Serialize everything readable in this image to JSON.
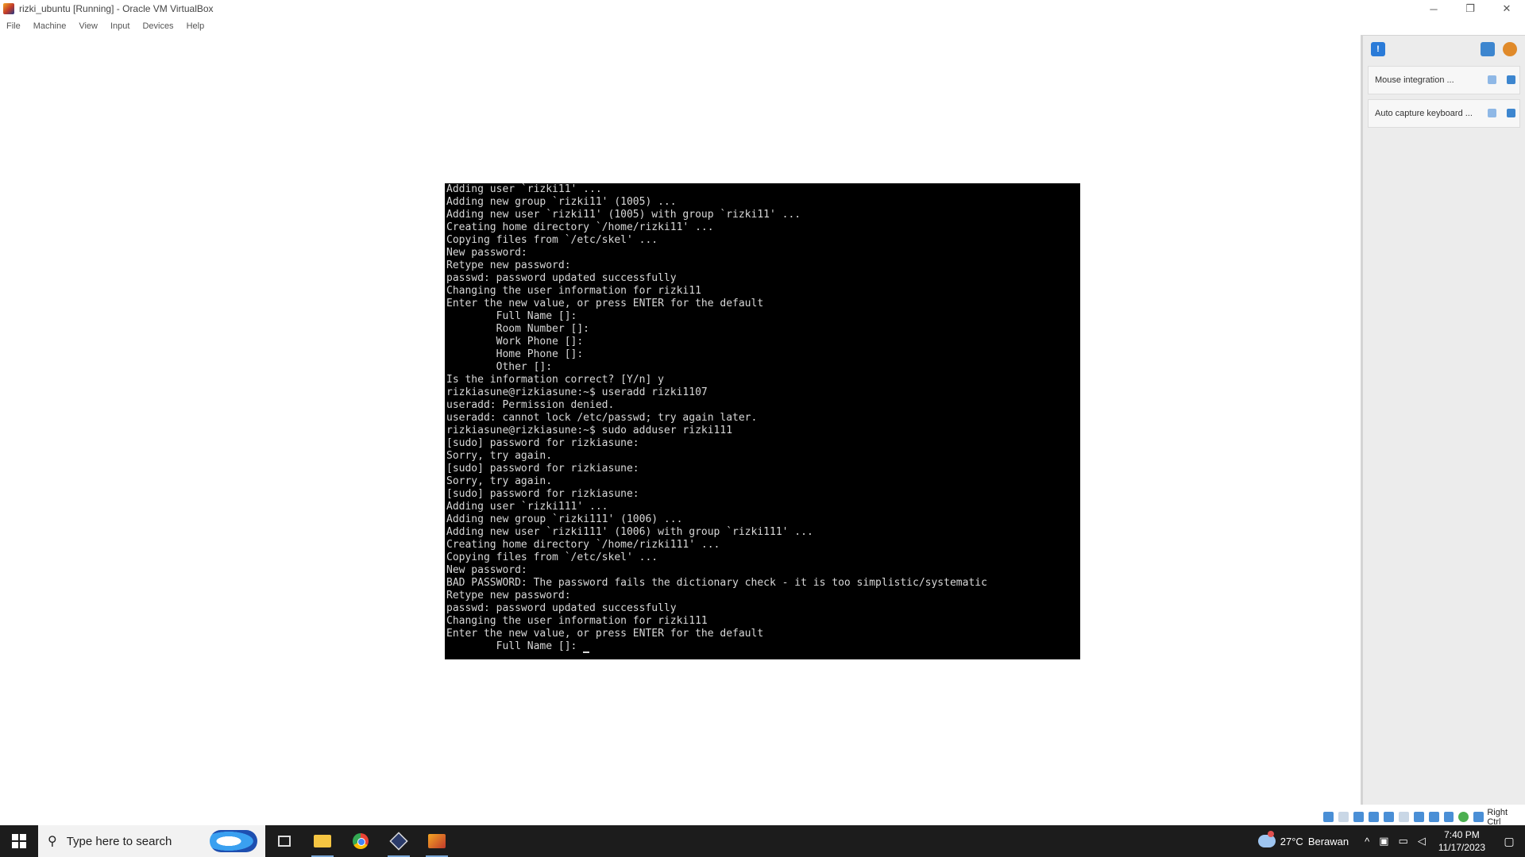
{
  "window": {
    "title": "rizki_ubuntu [Running] - Oracle VM VirtualBox",
    "minimize": "─",
    "restore": "❐",
    "close": "✕"
  },
  "menu": [
    "File",
    "Machine",
    "View",
    "Input",
    "Devices",
    "Help"
  ],
  "terminal": {
    "lines": [
      "Adding user `rizki11' ...",
      "Adding new group `rizki11' (1005) ...",
      "Adding new user `rizki11' (1005) with group `rizki11' ...",
      "Creating home directory `/home/rizki11' ...",
      "Copying files from `/etc/skel' ...",
      "New password:",
      "Retype new password:",
      "passwd: password updated successfully",
      "Changing the user information for rizki11",
      "Enter the new value, or press ENTER for the default",
      "        Full Name []:",
      "        Room Number []:",
      "        Work Phone []:",
      "        Home Phone []:",
      "        Other []:",
      "Is the information correct? [Y/n] y",
      "rizkiasune@rizkiasune:~$ useradd rizki1107",
      "useradd: Permission denied.",
      "useradd: cannot lock /etc/passwd; try again later.",
      "rizkiasune@rizkiasune:~$ sudo adduser rizki111",
      "[sudo] password for rizkiasune:",
      "Sorry, try again.",
      "[sudo] password for rizkiasune:",
      "Sorry, try again.",
      "[sudo] password for rizkiasune:",
      "Adding user `rizki111' ...",
      "Adding new group `rizki111' (1006) ...",
      "Adding new user `rizki111' (1006) with group `rizki111' ...",
      "Creating home directory `/home/rizki111' ...",
      "Copying files from `/etc/skel' ...",
      "New password:",
      "BAD PASSWORD: The password fails the dictionary check - it is too simplistic/systematic",
      "Retype new password:",
      "passwd: password updated successfully",
      "Changing the user information for rizki111",
      "Enter the new value, or press ENTER for the default",
      "        Full Name []: "
    ]
  },
  "notifications": [
    {
      "text": "Mouse integration ..."
    },
    {
      "text": "Auto capture keyboard ..."
    }
  ],
  "statusbar": {
    "host_key": "Right Ctrl"
  },
  "taskbar": {
    "search_placeholder": "Type here to search",
    "weather_temp": "27°C",
    "weather_desc": "Berawan",
    "tray_chevron": "^",
    "time": "7:40 PM",
    "date": "11/17/2023"
  }
}
